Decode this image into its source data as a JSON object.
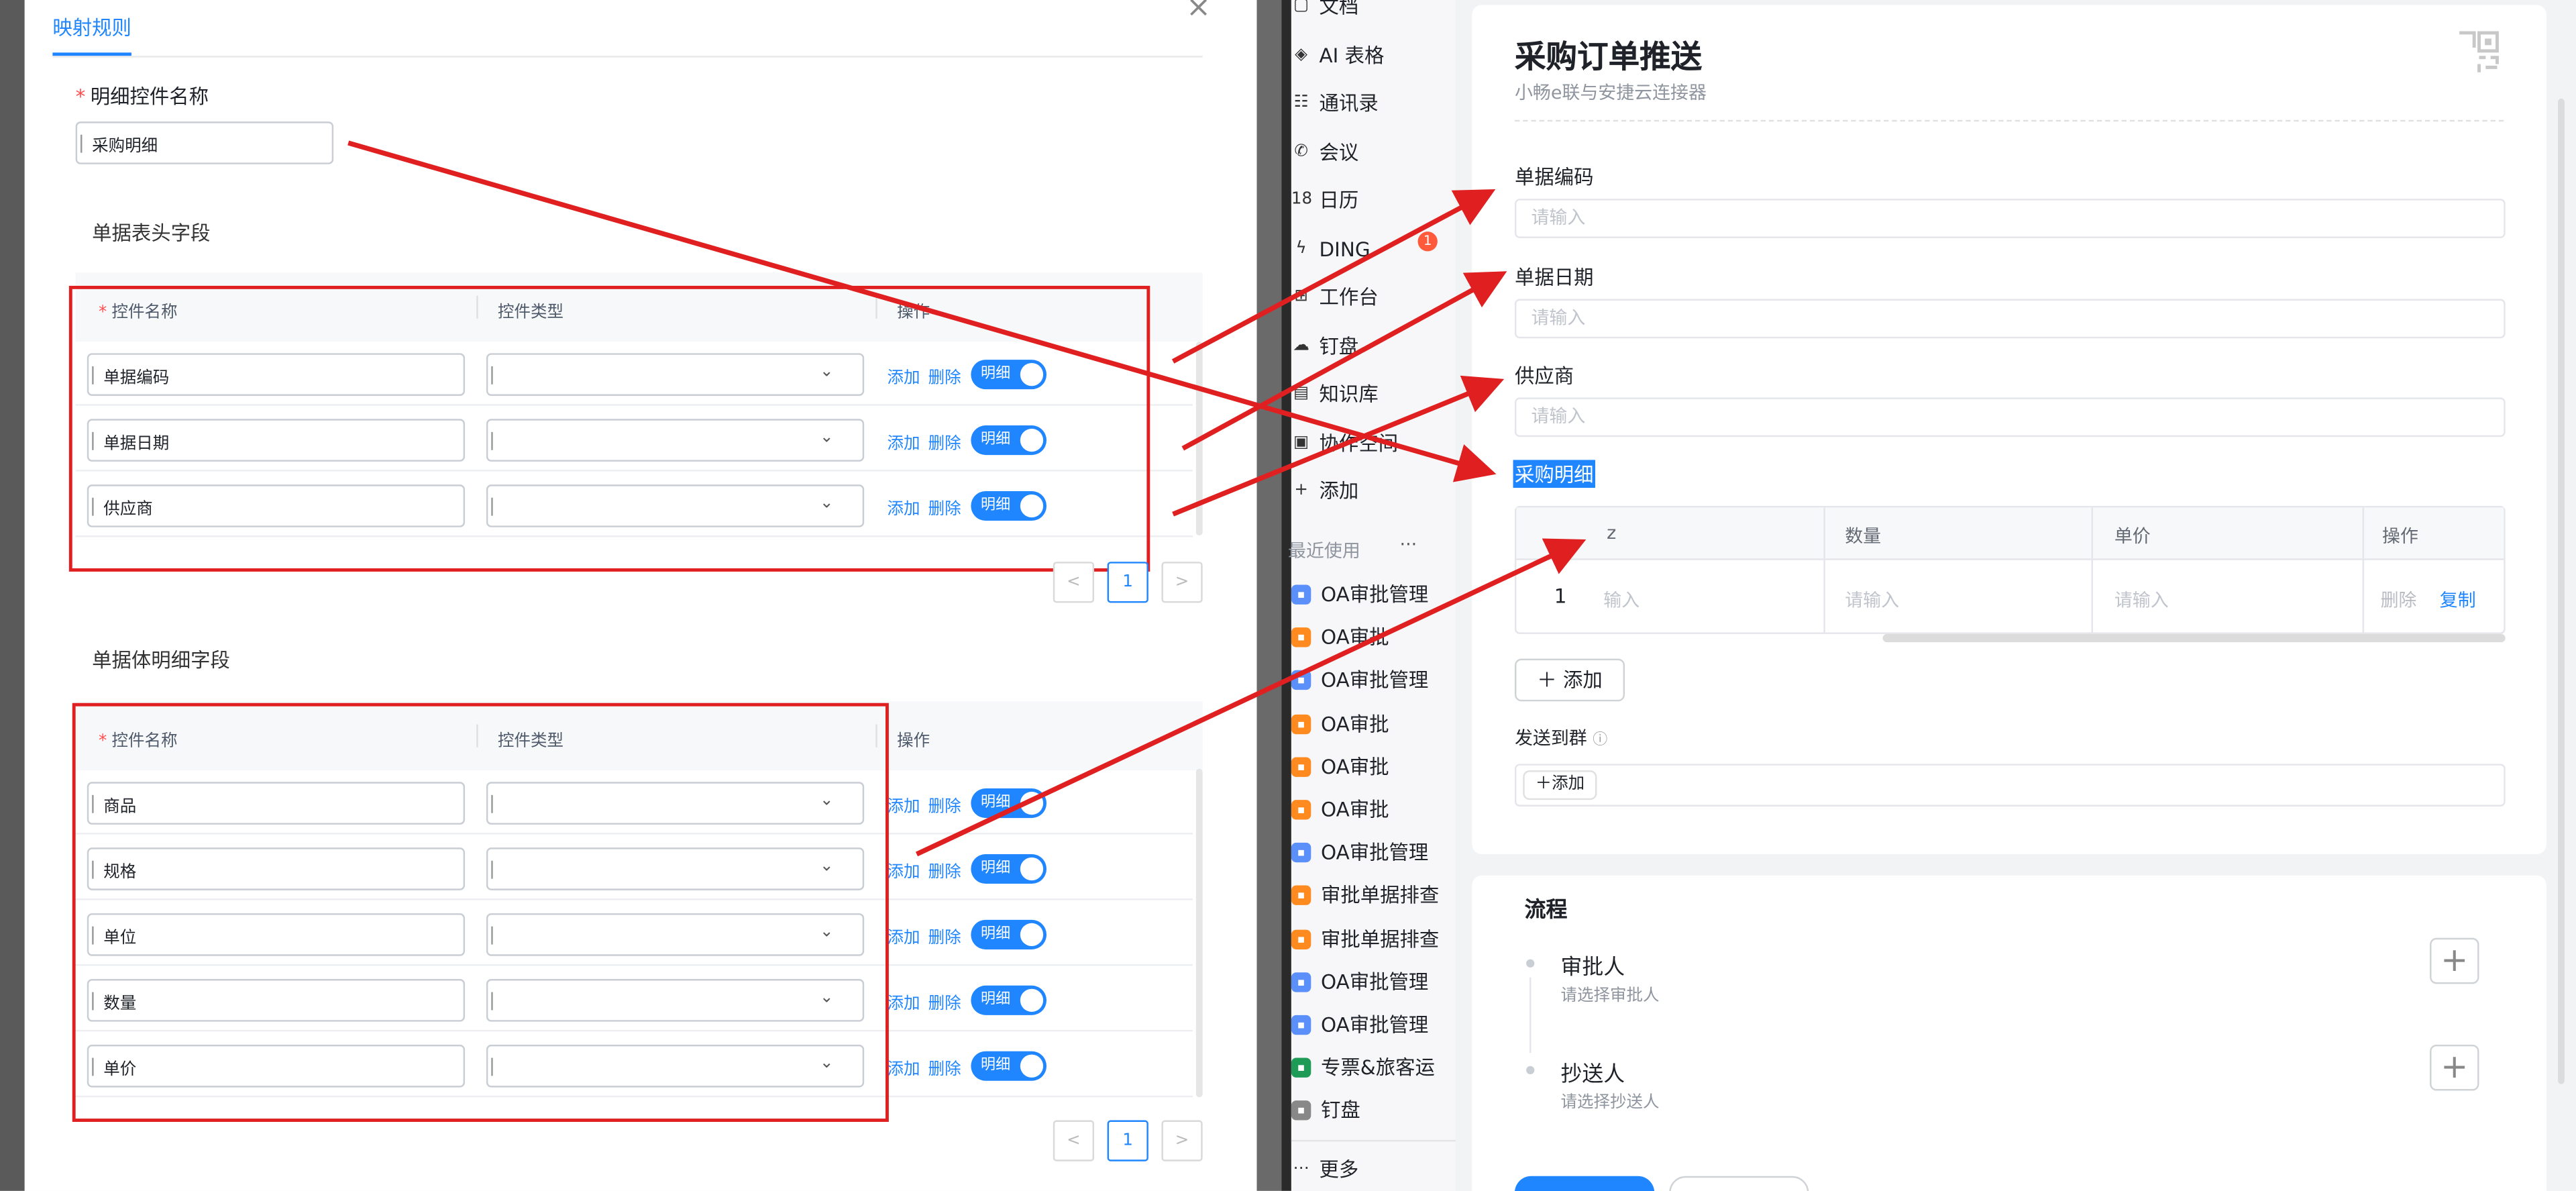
{
  "modal": {
    "tab": "映射规则",
    "close": "×",
    "detail_name_label": "明细控件名称",
    "detail_name_value": "采购明细",
    "header_section": "单据表头字段",
    "body_section": "单据体明细字段",
    "col_name": "控件名称",
    "col_type": "控件类型",
    "col_op": "操作",
    "op_add": "添加",
    "op_delete": "删除",
    "toggle_label": "明细",
    "header_rows": [
      "单据编码",
      "单据日期",
      "供应商"
    ],
    "body_rows": [
      "商品",
      "规格",
      "单位",
      "数量",
      "单价"
    ],
    "page_num": "1",
    "prev": "<",
    "next": ">"
  },
  "sidebar": {
    "items_top": [
      {
        "label": "文档",
        "icon": "doc-icon"
      },
      {
        "label": "AI 表格",
        "icon": "cube-icon"
      },
      {
        "label": "通讯录",
        "icon": "contacts-icon"
      },
      {
        "label": "会议",
        "icon": "phone-icon"
      },
      {
        "label": "日历",
        "icon": "calendar-icon"
      },
      {
        "label": "DING",
        "icon": "lightning-icon"
      },
      {
        "label": "工作台",
        "icon": "grid-icon"
      },
      {
        "label": "钉盘",
        "icon": "cloud-icon"
      },
      {
        "label": "知识库",
        "icon": "book-icon"
      },
      {
        "label": "协作空间",
        "icon": "folder-icon"
      },
      {
        "label": "添加",
        "icon": "plus-icon"
      }
    ],
    "ding_badge": "1",
    "calendar_num": "18",
    "recent_label": "最近使用",
    "recent_more": "···",
    "recent": [
      {
        "label": "OA审批管理",
        "color": "#5b8ff9"
      },
      {
        "label": "OA审批",
        "color": "#ff8a1f"
      },
      {
        "label": "OA审批管理",
        "color": "#5b8ff9"
      },
      {
        "label": "OA审批",
        "color": "#ff8a1f"
      },
      {
        "label": "OA审批",
        "color": "#ff8a1f"
      },
      {
        "label": "OA审批",
        "color": "#ff8a1f"
      },
      {
        "label": "OA审批管理",
        "color": "#5b8ff9"
      },
      {
        "label": "审批单据排查",
        "color": "#ff8a1f"
      },
      {
        "label": "审批单据排查",
        "color": "#ff8a1f"
      },
      {
        "label": "OA审批管理",
        "color": "#5b8ff9"
      },
      {
        "label": "OA审批管理",
        "color": "#5b8ff9"
      },
      {
        "label": "专票&旅客运",
        "color": "#1d9b57"
      },
      {
        "label": "钉盘",
        "color": "#888888"
      }
    ],
    "more": "更多"
  },
  "form": {
    "title": "采购订单推送",
    "subtitle": "小畅e联与安捷云连接器",
    "fields": [
      {
        "label": "单据编码",
        "placeholder": "请输入"
      },
      {
        "label": "单据日期",
        "placeholder": "请输入"
      },
      {
        "label": "供应商",
        "placeholder": "请输入"
      }
    ],
    "detail_label": "采购明细",
    "grid_cols": [
      "z",
      "数量",
      "单价",
      "操作"
    ],
    "grid_row_index": "1",
    "grid_placeholder": "请输入",
    "grid_placeholder_partial": "输入",
    "grid_delete": "删除",
    "grid_copy": "复制",
    "add_button": "添加",
    "send_group_label": "发送到群",
    "send_add": "添加",
    "flow_title": "流程",
    "approver": "审批人",
    "approver_hint": "请选择审批人",
    "cc": "抄送人",
    "cc_hint": "请选择抄送人"
  }
}
